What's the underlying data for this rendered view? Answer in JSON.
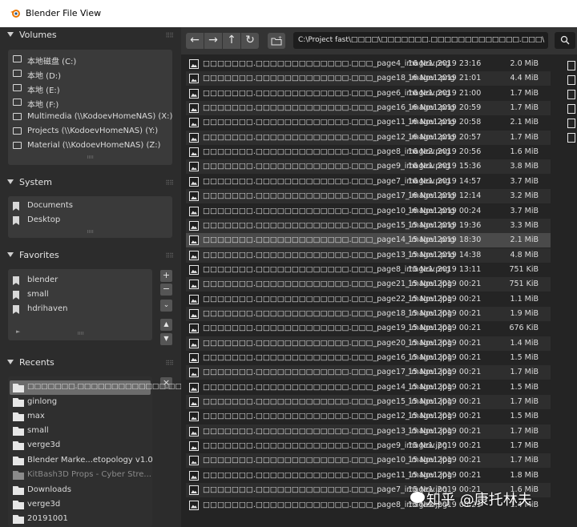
{
  "window": {
    "title": "Blender File View"
  },
  "volumes": {
    "header": "Volumes",
    "items": [
      "本地磁盘 (C:)",
      "本地 (D:)",
      "本地 (E:)",
      "本地 (F:)",
      "Multimedia (\\\\KodoevHomeNAS) (X:)",
      "Projects (\\\\KodoevHomeNAS) (Y:)",
      "Material (\\\\KodoevHomeNAS) (Z:)"
    ]
  },
  "system": {
    "header": "System",
    "items": [
      "Documents",
      "Desktop"
    ]
  },
  "favorites": {
    "header": "Favorites",
    "items": [
      "blender",
      "small",
      "hdrihaven"
    ],
    "buttons": {
      "add": "+",
      "remove": "−",
      "menu": "⌄",
      "up": "▲",
      "down": "▼"
    }
  },
  "recents": {
    "header": "Recents",
    "items": [
      "□□□□□□□.□□□□□□□□□□□□□.□□□",
      "ginlong",
      "max",
      "small",
      "verge3d",
      "Blender Marke...etopology v1.0",
      "KitBash3D Props - Cyber Stre...",
      "Downloads",
      "verge3d",
      "20191001"
    ],
    "close": "×"
  },
  "toolbar": {
    "back": "←",
    "forward": "→",
    "parent": "↑",
    "refresh": "↻",
    "new_folder": "+",
    "path": "C:\\Project fast\\□□□□\\□□□□□□□.□□□□□□□□□□□□□.□□□\\",
    "search": "⌕"
  },
  "files": [
    {
      "name": "□□□□□□□.□□□□□□□□□□□□□.□□□_page4_image1.png",
      "date": "16 Nov 2019 23:16",
      "size": "2.0 MiB"
    },
    {
      "name": "□□□□□□□.□□□□□□□□□□□□□.□□□_page18_image1.png",
      "date": "16 Nov 2019 21:01",
      "size": "4.4 MiB"
    },
    {
      "name": "□□□□□□□.□□□□□□□□□□□□□.□□□_page6_image1.png",
      "date": "16 Nov 2019 21:00",
      "size": "1.7 MiB"
    },
    {
      "name": "□□□□□□□.□□□□□□□□□□□□□.□□□_page16_image1.png",
      "date": "16 Nov 2019 20:59",
      "size": "1.7 MiB"
    },
    {
      "name": "□□□□□□□.□□□□□□□□□□□□□.□□□_page11_image1.png",
      "date": "16 Nov 2019 20:58",
      "size": "2.1 MiB"
    },
    {
      "name": "□□□□□□□.□□□□□□□□□□□□□.□□□_page12_image1.png",
      "date": "16 Nov 2019 20:57",
      "size": "1.7 MiB"
    },
    {
      "name": "□□□□□□□.□□□□□□□□□□□□□.□□□_page8_image2.png",
      "date": "16 Nov 2019 20:56",
      "size": "1.6 MiB"
    },
    {
      "name": "□□□□□□□.□□□□□□□□□□□□□.□□□_page9_image1.png",
      "date": "16 Nov 2019 15:36",
      "size": "3.8 MiB"
    },
    {
      "name": "□□□□□□□.□□□□□□□□□□□□□.□□□_page7_image1.png",
      "date": "16 Nov 2019 14:57",
      "size": "3.7 MiB"
    },
    {
      "name": "□□□□□□□.□□□□□□□□□□□□□.□□□_page17_image1.png",
      "date": "16 Nov 2019 12:14",
      "size": "3.2 MiB"
    },
    {
      "name": "□□□□□□□.□□□□□□□□□□□□□.□□□_page10_image1.png",
      "date": "16 Nov 2019 00:24",
      "size": "3.7 MiB"
    },
    {
      "name": "□□□□□□□.□□□□□□□□□□□□□.□□□_page15_image1.png",
      "date": "15 Nov 2019 19:36",
      "size": "3.3 MiB"
    },
    {
      "name": "□□□□□□□.□□□□□□□□□□□□□.□□□_page14_image1.png",
      "date": "15 Nov 2019 18:30",
      "size": "2.1 MiB"
    },
    {
      "name": "□□□□□□□.□□□□□□□□□□□□□.□□□_page13_image1.png",
      "date": "15 Nov 2019 14:38",
      "size": "4.8 MiB"
    },
    {
      "name": "□□□□□□□.□□□□□□□□□□□□□.□□□_page8_image1.png",
      "date": "15 Nov 2019 13:11",
      "size": "751 KiB"
    },
    {
      "name": "□□□□□□□.□□□□□□□□□□□□□.□□□_page21_image1.jpg",
      "date": "15 Nov 2019 00:21",
      "size": "751 KiB"
    },
    {
      "name": "□□□□□□□.□□□□□□□□□□□□□.□□□_page22_image1.jpg",
      "date": "15 Nov 2019 00:21",
      "size": "1.1 MiB"
    },
    {
      "name": "□□□□□□□.□□□□□□□□□□□□□.□□□_page18_image1.jpg",
      "date": "15 Nov 2019 00:21",
      "size": "1.9 MiB"
    },
    {
      "name": "□□□□□□□.□□□□□□□□□□□□□.□□□_page19_image1.jpg",
      "date": "15 Nov 2019 00:21",
      "size": "676 KiB"
    },
    {
      "name": "□□□□□□□.□□□□□□□□□□□□□.□□□_page20_image1.jpg",
      "date": "15 Nov 2019 00:21",
      "size": "1.4 MiB"
    },
    {
      "name": "□□□□□□□.□□□□□□□□□□□□□.□□□_page16_image1.jpg",
      "date": "15 Nov 2019 00:21",
      "size": "1.5 MiB"
    },
    {
      "name": "□□□□□□□.□□□□□□□□□□□□□.□□□_page17_image1.jpg",
      "date": "15 Nov 2019 00:21",
      "size": "1.7 MiB"
    },
    {
      "name": "□□□□□□□.□□□□□□□□□□□□□.□□□_page14_image1.jpg",
      "date": "15 Nov 2019 00:21",
      "size": "1.5 MiB"
    },
    {
      "name": "□□□□□□□.□□□□□□□□□□□□□.□□□_page15_image1.jpg",
      "date": "15 Nov 2019 00:21",
      "size": "1.7 MiB"
    },
    {
      "name": "□□□□□□□.□□□□□□□□□□□□□.□□□_page12_image1.jpg",
      "date": "15 Nov 2019 00:21",
      "size": "1.5 MiB"
    },
    {
      "name": "□□□□□□□.□□□□□□□□□□□□□.□□□_page13_image1.jpg",
      "date": "15 Nov 2019 00:21",
      "size": "1.7 MiB"
    },
    {
      "name": "□□□□□□□.□□□□□□□□□□□□□.□□□_page9_image1.jpg",
      "date": "15 Nov 2019 00:21",
      "size": "1.7 MiB"
    },
    {
      "name": "□□□□□□□.□□□□□□□□□□□□□.□□□_page10_image1.jpg",
      "date": "15 Nov 2019 00:21",
      "size": "1.7 MiB"
    },
    {
      "name": "□□□□□□□.□□□□□□□□□□□□□.□□□_page11_image1.jpg",
      "date": "15 Nov 2019 00:21",
      "size": "1.8 MiB"
    },
    {
      "name": "□□□□□□□.□□□□□□□□□□□□□.□□□_page7_image1.jpg",
      "date": "15 Nov 2019 00:21",
      "size": "1.6 MiB"
    },
    {
      "name": "□□□□□□□.□□□□□□□□□□□□□.□□□_page8_image1.jpg",
      "date": "15 Nov 2019 00:21",
      "size": "1.4 MiB"
    }
  ],
  "selected_file_index": 12,
  "watermark": {
    "text": "知乎 @康托林夫"
  },
  "colors": {
    "panel": "#2c2c2c",
    "list_bg": "#242424",
    "selected_row": "#4a4a4a",
    "title_bar": "#ffffff"
  }
}
